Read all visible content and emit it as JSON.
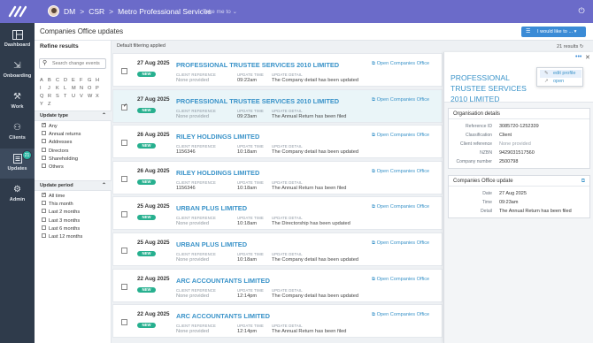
{
  "topbar": {
    "breadcrumb": [
      "DM",
      "CSR",
      "Metro Professional Services"
    ],
    "take_me_to": "Take me to",
    "accent": "#6b6bc9"
  },
  "sidebar": {
    "items": [
      {
        "label": "Dashboard",
        "icon": "dashboard-icon"
      },
      {
        "label": "Onboarding",
        "icon": "onboarding-icon"
      },
      {
        "label": "Work",
        "icon": "work-icon"
      },
      {
        "label": "Clients",
        "icon": "clients-icon"
      },
      {
        "label": "Updates",
        "icon": "updates-icon",
        "badge": "21",
        "active": true
      },
      {
        "label": "Admin",
        "icon": "admin-icon"
      }
    ]
  },
  "header": {
    "title": "Companies Office updates",
    "action_button": "I would like to ..."
  },
  "filters": {
    "title": "Refine results",
    "search_placeholder": "Search change events",
    "alphabet": [
      "A",
      "B",
      "C",
      "D",
      "E",
      "F",
      "G",
      "H",
      "I",
      "J",
      "K",
      "L",
      "M",
      "N",
      "O",
      "P",
      "Q",
      "R",
      "S",
      "T",
      "U",
      "V",
      "W",
      "X",
      "Y",
      "Z"
    ],
    "update_type": {
      "title": "Update type",
      "options": [
        {
          "label": "Any",
          "checked": true
        },
        {
          "label": "Annual returns",
          "checked": false
        },
        {
          "label": "Addresses",
          "checked": false
        },
        {
          "label": "Directors",
          "checked": false
        },
        {
          "label": "Shareholding",
          "checked": false
        },
        {
          "label": "Others",
          "checked": false
        }
      ]
    },
    "update_period": {
      "title": "Update period",
      "options": [
        {
          "label": "All time",
          "checked": true
        },
        {
          "label": "This month",
          "checked": false
        },
        {
          "label": "Last 2 months",
          "checked": false
        },
        {
          "label": "Last 3 months",
          "checked": false
        },
        {
          "label": "Last 6 months",
          "checked": false
        },
        {
          "label": "Last 12 months",
          "checked": false
        }
      ]
    }
  },
  "results": {
    "default_filtering": "Default filtering applied",
    "count": "21 results",
    "column_labels": {
      "ref": "CLIENT REFERENCE",
      "time": "UPDATE TIME",
      "detail": "UPDATE DETAIL"
    },
    "badge_new": "NEW",
    "open_link": "Open Companies Office",
    "rows": [
      {
        "date": "27 Aug 2025",
        "name": "PROFESSIONAL TRUSTEE SERVICES 2010 LIMITED",
        "ref": "None provided",
        "time": "09:22am",
        "detail": "The Company detail has been updated",
        "checked": false,
        "selected": false
      },
      {
        "date": "27 Aug 2025",
        "name": "PROFESSIONAL TRUSTEE SERVICES 2010 LIMITED",
        "ref": "None provided",
        "time": "09:23am",
        "detail": "The Annual Return has been filed",
        "checked": true,
        "selected": true
      },
      {
        "date": "26 Aug 2025",
        "name": "RILEY HOLDINGS LIMITED",
        "ref": "1156346",
        "time": "10:18am",
        "detail": "The Company detail has been updated",
        "checked": false,
        "selected": false
      },
      {
        "date": "26 Aug 2025",
        "name": "RILEY HOLDINGS LIMITED",
        "ref": "1156346",
        "time": "10:18am",
        "detail": "The Annual Return has been filed",
        "checked": false,
        "selected": false
      },
      {
        "date": "25 Aug 2025",
        "name": "URBAN PLUS LIMITED",
        "ref": "None provided",
        "time": "10:18am",
        "detail": "The Directorship has been updated",
        "checked": false,
        "selected": false
      },
      {
        "date": "25 Aug 2025",
        "name": "URBAN PLUS LIMITED",
        "ref": "None provided",
        "time": "10:18am",
        "detail": "The Company detail has been updated",
        "checked": false,
        "selected": false
      },
      {
        "date": "22 Aug 2025",
        "name": "ARC ACCOUNTANTS LIMITED",
        "ref": "None provided",
        "time": "12:14pm",
        "detail": "The Company detail has been updated",
        "checked": false,
        "selected": false
      },
      {
        "date": "22 Aug 2025",
        "name": "ARC ACCOUNTANTS LIMITED",
        "ref": "None provided",
        "time": "12:14pm",
        "detail": "The Annual Return has been filed",
        "checked": false,
        "selected": false
      }
    ]
  },
  "detail": {
    "title": "PROFESSIONAL TRUSTEE SERVICES 2010 LIMITED",
    "menu": [
      "edit profile",
      "open"
    ],
    "org": {
      "title": "Organisation details",
      "fields": [
        {
          "k": "Reference ID",
          "v": "3085720-1252339",
          "muted": false
        },
        {
          "k": "Classification",
          "v": "Client",
          "muted": false
        },
        {
          "k": "Client reference",
          "v": "None provided",
          "muted": true
        },
        {
          "k": "NZBN",
          "v": "9429031517560",
          "muted": false
        },
        {
          "k": "Company number",
          "v": "2500798",
          "muted": false
        }
      ]
    },
    "update": {
      "title": "Companies Office update",
      "fields": [
        {
          "k": "Date",
          "v": "27 Aug 2025",
          "muted": false
        },
        {
          "k": "Time",
          "v": "09:23am",
          "muted": false
        },
        {
          "k": "Detail",
          "v": "The Annual Return has been filed",
          "muted": false
        }
      ]
    }
  }
}
